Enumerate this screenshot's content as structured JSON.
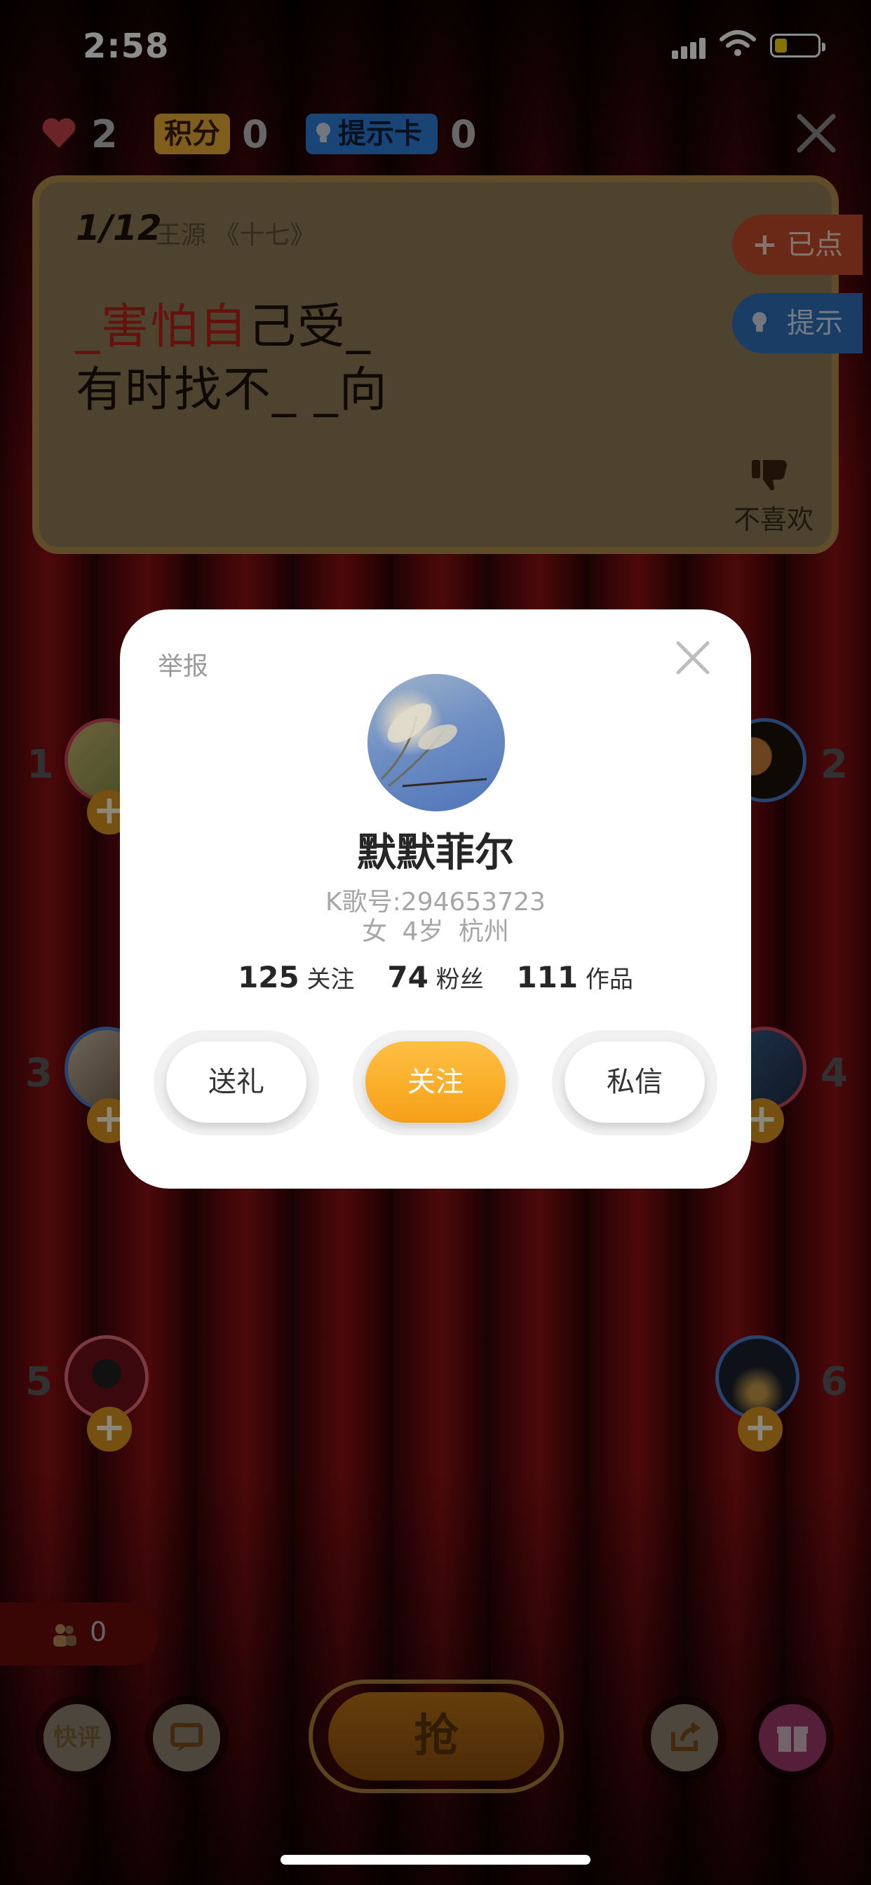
{
  "status_bar": {
    "time": "2:58"
  },
  "top_bar": {
    "lives_count": "2",
    "score_label": "积分",
    "score_count": "0",
    "hint_card_label": "提示卡",
    "hint_card_count": "0"
  },
  "lyrics_card": {
    "progress": "1/12",
    "song_info": "王源 《十七》",
    "line1_prefix": "_",
    "line1_highlight": "害怕自",
    "line1_rest": "己受_",
    "line2": "有时找不_ _向",
    "ordered_button": "已点",
    "hint_button": "提示",
    "dislike_label": "不喜欢"
  },
  "players": [
    {
      "slot": "1"
    },
    {
      "slot": "2"
    },
    {
      "slot": "3"
    },
    {
      "slot": "4"
    },
    {
      "slot": "5"
    },
    {
      "slot": "6"
    }
  ],
  "profile_modal": {
    "report": "举报",
    "name": "默默菲尔",
    "k_song_id": "K歌号:294653723",
    "meta": "女  4岁  杭州",
    "stats": {
      "following_count": "125",
      "following_label": "关注",
      "fans_count": "74",
      "fans_label": "粉丝",
      "works_count": "111",
      "works_label": "作品"
    },
    "buttons": {
      "gift": "送礼",
      "follow": "关注",
      "message": "私信"
    }
  },
  "bottom_bar": {
    "audience_count": "0",
    "quick_comment": "快评",
    "grab_button": "抢"
  },
  "colors": {
    "accent_orange": "#f5a017",
    "lyric_highlight": "#b8221b",
    "hint_blue": "#2c7fd6",
    "score_gold": "#e8a933"
  }
}
